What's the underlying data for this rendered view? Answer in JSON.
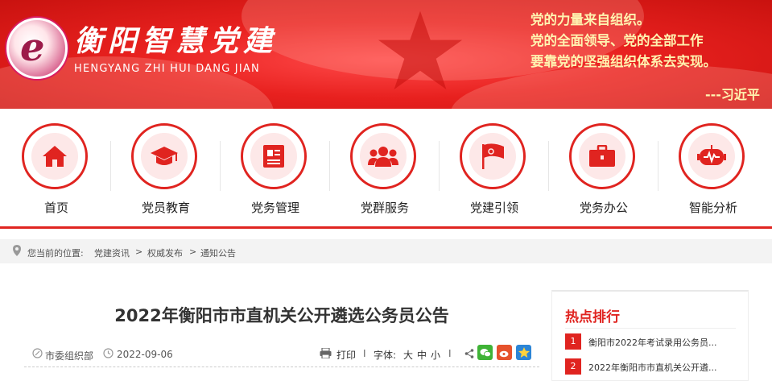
{
  "banner": {
    "logo_title": "衡阳智慧党建",
    "logo_subtitle": "HENGYANG ZHI HUI DANG JIAN",
    "quote_lines": [
      "党的力量来自组织。",
      "党的全面领导、党的全部工作",
      "要靠党的坚强组织体系去实现。"
    ],
    "quote_author": "---习近平"
  },
  "nav": {
    "items": [
      {
        "label": "首页",
        "icon": "home-icon"
      },
      {
        "label": "党员教育",
        "icon": "graduation-cap-icon"
      },
      {
        "label": "党务管理",
        "icon": "document-icon"
      },
      {
        "label": "党群服务",
        "icon": "people-group-icon"
      },
      {
        "label": "党建引领",
        "icon": "party-flag-icon"
      },
      {
        "label": "党务办公",
        "icon": "briefcase-icon"
      },
      {
        "label": "智能分析",
        "icon": "analytics-robot-icon"
      }
    ]
  },
  "breadcrumb": {
    "prefix": "您当前的位置:",
    "items": [
      "党建资讯",
      "权威发布",
      "通知公告"
    ],
    "separator": ">"
  },
  "article": {
    "title": "2022年衡阳市市直机关公开遴选公务员公告",
    "author": "市委组织部",
    "date": "2022-09-06",
    "print_label": "打印",
    "font_label": "字体:",
    "font_sizes": [
      "大",
      "中",
      "小"
    ],
    "divider": "I"
  },
  "hot": {
    "title": "热点排行",
    "items": [
      {
        "rank": "1",
        "text": "衡阳市2022年考试录用公务员..."
      },
      {
        "rank": "2",
        "text": "2022年衡阳市市直机关公开遴..."
      }
    ]
  },
  "colors": {
    "primary_red": "#e02420",
    "quote_yellow": "#fff3b0"
  }
}
